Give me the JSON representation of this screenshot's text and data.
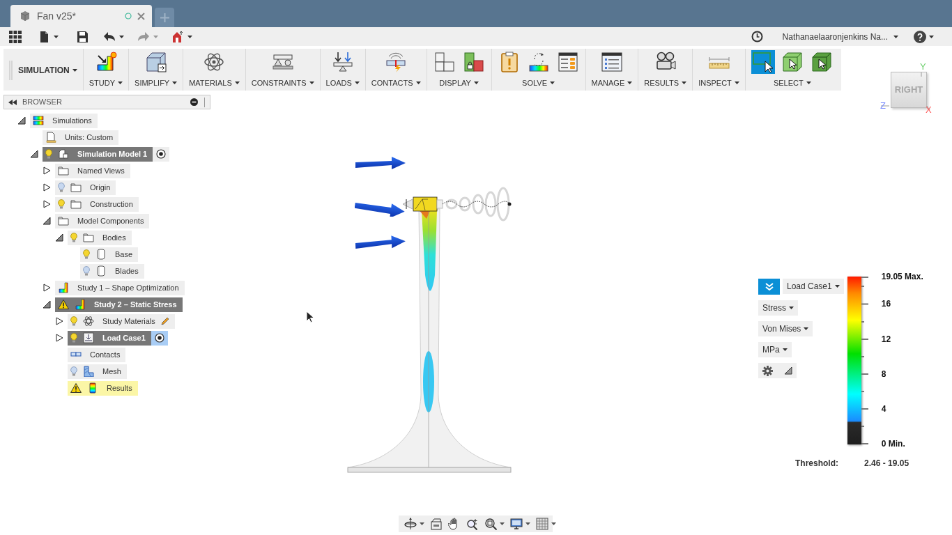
{
  "document_tab": {
    "title": "Fan v25*"
  },
  "quick_access": {
    "user": "Nathanaelaaronjenkins Na..."
  },
  "toolbar": {
    "workspace": "SIMULATION",
    "groups": [
      {
        "label": "STUDY",
        "tools": [
          {
            "kind": "study"
          }
        ]
      },
      {
        "label": "SIMPLIFY",
        "tools": [
          {
            "kind": "simplify"
          }
        ]
      },
      {
        "label": "MATERIALS",
        "tools": [
          {
            "kind": "materials"
          }
        ]
      },
      {
        "label": "CONSTRAINTS",
        "tools": [
          {
            "kind": "constraints"
          }
        ]
      },
      {
        "label": "LOADS",
        "tools": [
          {
            "kind": "loads"
          }
        ]
      },
      {
        "label": "CONTACTS",
        "tools": [
          {
            "kind": "contacts"
          }
        ]
      },
      {
        "label": "DISPLAY",
        "tools": [
          {
            "kind": "blocks"
          },
          {
            "kind": "lock"
          }
        ]
      },
      {
        "label": "SOLVE",
        "tools": [
          {
            "kind": "precheck"
          },
          {
            "kind": "solve"
          },
          {
            "kind": "jobs"
          }
        ]
      },
      {
        "label": "MANAGE",
        "tools": [
          {
            "kind": "manage"
          }
        ]
      },
      {
        "label": "RESULTS",
        "tools": [
          {
            "kind": "results"
          }
        ]
      },
      {
        "label": "INSPECT",
        "tools": [
          {
            "kind": "inspect"
          }
        ]
      },
      {
        "label": "SELECT",
        "tools": [
          {
            "kind": "select-window",
            "selected": true
          },
          {
            "kind": "select-box",
            "selected": false
          },
          {
            "kind": "select-solid",
            "selected": false
          }
        ]
      }
    ]
  },
  "browser": {
    "title": "BROWSER",
    "tree": [
      {
        "label": "Simulations",
        "kind": "simulations",
        "expanded": true,
        "active": false,
        "warning": false,
        "selected": false,
        "children": [
          {
            "label": "Units: Custom",
            "kind": "units",
            "active": false,
            "warning": false,
            "selected": false
          },
          {
            "label": "Simulation Model 1",
            "kind": "model",
            "visible": true,
            "expanded": true,
            "active": true,
            "warning": false,
            "selected": false,
            "activator": true,
            "children": [
              {
                "label": "Named Views",
                "kind": "folder",
                "expanded": false,
                "active": false,
                "warning": false,
                "selected": false
              },
              {
                "label": "Origin",
                "kind": "folder",
                "visible": false,
                "expanded": false,
                "active": false,
                "warning": false,
                "selected": false
              },
              {
                "label": "Construction",
                "kind": "folder",
                "visible": true,
                "expanded": false,
                "active": false,
                "warning": false,
                "selected": false
              },
              {
                "label": "Model Components",
                "kind": "folder",
                "expanded": true,
                "active": false,
                "warning": false,
                "selected": false,
                "children": [
                  {
                    "label": "Bodies",
                    "kind": "folder",
                    "visible": true,
                    "expanded": true,
                    "active": false,
                    "warning": false,
                    "selected": false,
                    "children": [
                      {
                        "label": "Base",
                        "kind": "body",
                        "visible": true,
                        "active": false,
                        "warning": false,
                        "selected": false
                      },
                      {
                        "label": "Blades",
                        "kind": "body",
                        "visible": false,
                        "active": false,
                        "warning": false,
                        "selected": false
                      }
                    ]
                  }
                ]
              },
              {
                "label": "Study 1 – Shape Optimization",
                "kind": "study",
                "expanded": false,
                "active": false,
                "warning": false,
                "selected": false
              },
              {
                "label": "Study 2 – Static Stress",
                "kind": "study",
                "expanded": true,
                "active": true,
                "warning": true,
                "selected": false,
                "children": [
                  {
                    "label": "Study Materials",
                    "kind": "materials",
                    "visible": true,
                    "expanded": false,
                    "active": false,
                    "warning": false,
                    "selected": false,
                    "editable": true
                  },
                  {
                    "label": "Load Case1",
                    "kind": "loadcase",
                    "visible": true,
                    "expanded": false,
                    "active": true,
                    "warning": false,
                    "selected": true,
                    "activator": true
                  },
                  {
                    "label": "Contacts",
                    "kind": "contacts",
                    "active": false,
                    "warning": false,
                    "selected": false
                  },
                  {
                    "label": "Mesh",
                    "kind": "mesh",
                    "visible": false,
                    "active": false,
                    "warning": false,
                    "selected": false
                  },
                  {
                    "label": "Results",
                    "kind": "results",
                    "active": false,
                    "warning": true,
                    "selected": false
                  }
                ]
              }
            ]
          }
        ]
      }
    ]
  },
  "legend": {
    "load_case": "Load Case1",
    "result_type": "Stress",
    "component": "Von Mises",
    "unit": "MPa",
    "scale_labels": [
      "19.05 Max.",
      "16",
      "12",
      "8",
      "4",
      "0 Min."
    ],
    "threshold_label": "Threshold:",
    "threshold_value": "2.46 - 19.05"
  },
  "view_cube": {
    "face": "RIGHT",
    "axis_y": "Y",
    "axis_z": "Z",
    "axis_x": "X"
  }
}
